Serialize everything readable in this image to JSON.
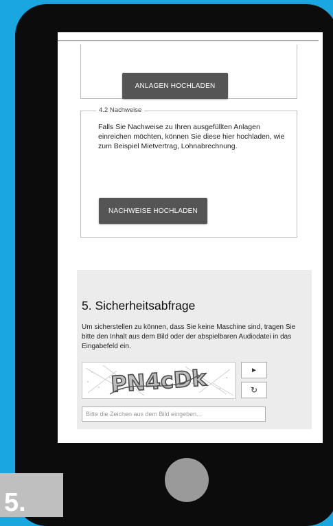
{
  "form": {
    "section4_1": {
      "upload_label": "ANLAGEN HOCHLADEN"
    },
    "section4_2": {
      "legend": "4.2 Nachweise",
      "description": "Falls Sie Nachweise zu Ihren ausgefüllten Anlagen einreichen möchten, können Sie diese hier hochladen, wie zum Beispiel Mietvertrag, Lohnabrechnung.",
      "upload_label": "NACHWEISE HOCHLADEN"
    },
    "security": {
      "title": "5. Sicherheitsabfrage",
      "text": "Um sicherstellen zu können, dass Sie keine Maschine sind, tragen Sie bitte den Inhalt aus dem Bild oder der abspielbaren Audiodatei in das Eingabefeld ein.",
      "captcha_text": "PN4cDk",
      "play_icon": "play-icon",
      "reload_icon": "reload-icon",
      "input_placeholder": "Bitte die Zeichen aus dem Bild eingeben..."
    }
  },
  "step_badge": {
    "label": "5."
  },
  "colors": {
    "background": "#1aa7df",
    "phone": "#0c0c0c",
    "button": "#555555",
    "section_bg": "#ececec",
    "home_button": "#9a9a9a",
    "badge": "#bfbfbf"
  }
}
